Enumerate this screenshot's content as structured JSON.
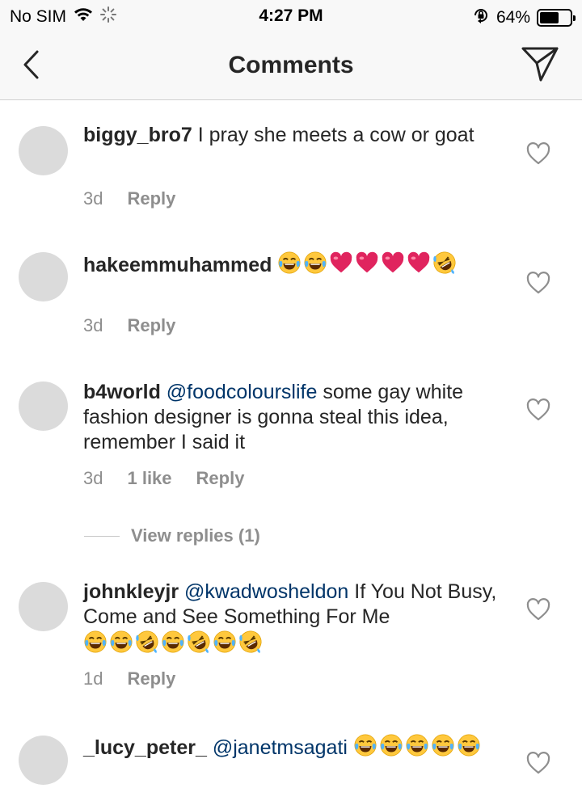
{
  "status_bar": {
    "carrier": "No SIM",
    "time": "4:27 PM",
    "battery": "64%",
    "battery_level": 0.64
  },
  "header": {
    "title": "Comments",
    "back_icon": "chevron-left-icon",
    "send_icon": "paper-plane-icon"
  },
  "comments": [
    {
      "username": "biggy_bro7",
      "mention": "",
      "text": "I pray she meets a cow or goat",
      "emojis": [],
      "time": "3d",
      "likes": "",
      "reply": "Reply"
    },
    {
      "username": "hakeemmuhammed",
      "mention": "",
      "text": "",
      "emojis": [
        "joy",
        "joy",
        "heart",
        "heart",
        "heart",
        "heart",
        "rofl"
      ],
      "time": "3d",
      "likes": "",
      "reply": "Reply"
    },
    {
      "username": "b4world",
      "mention": "@foodcolourslife",
      "text": "some gay white fashion designer is gonna steal this idea, remember I said it",
      "emojis": [],
      "time": "3d",
      "likes": "1 like",
      "reply": "Reply",
      "view_replies": "View replies (1)"
    },
    {
      "username": "johnkleyjr",
      "mention": "@kwadwosheldon",
      "text": "If You Not Busy, Come and See Something For Me",
      "emojis": [
        "joy",
        "joy",
        "rofl",
        "joy",
        "rofl",
        "joy",
        "rofl"
      ],
      "time": "1d",
      "likes": "",
      "reply": "Reply"
    },
    {
      "username": "_lucy_peter_",
      "mention": "@janetmsagati",
      "text": "",
      "emojis": [
        "joy",
        "joy",
        "joy",
        "joy",
        "joy"
      ],
      "time": "",
      "likes": "",
      "reply": ""
    }
  ],
  "colors": {
    "mention": "#003569",
    "meta": "#8e8e8e",
    "heart": "#e0245e",
    "emoji_face": "#ffc83d"
  }
}
